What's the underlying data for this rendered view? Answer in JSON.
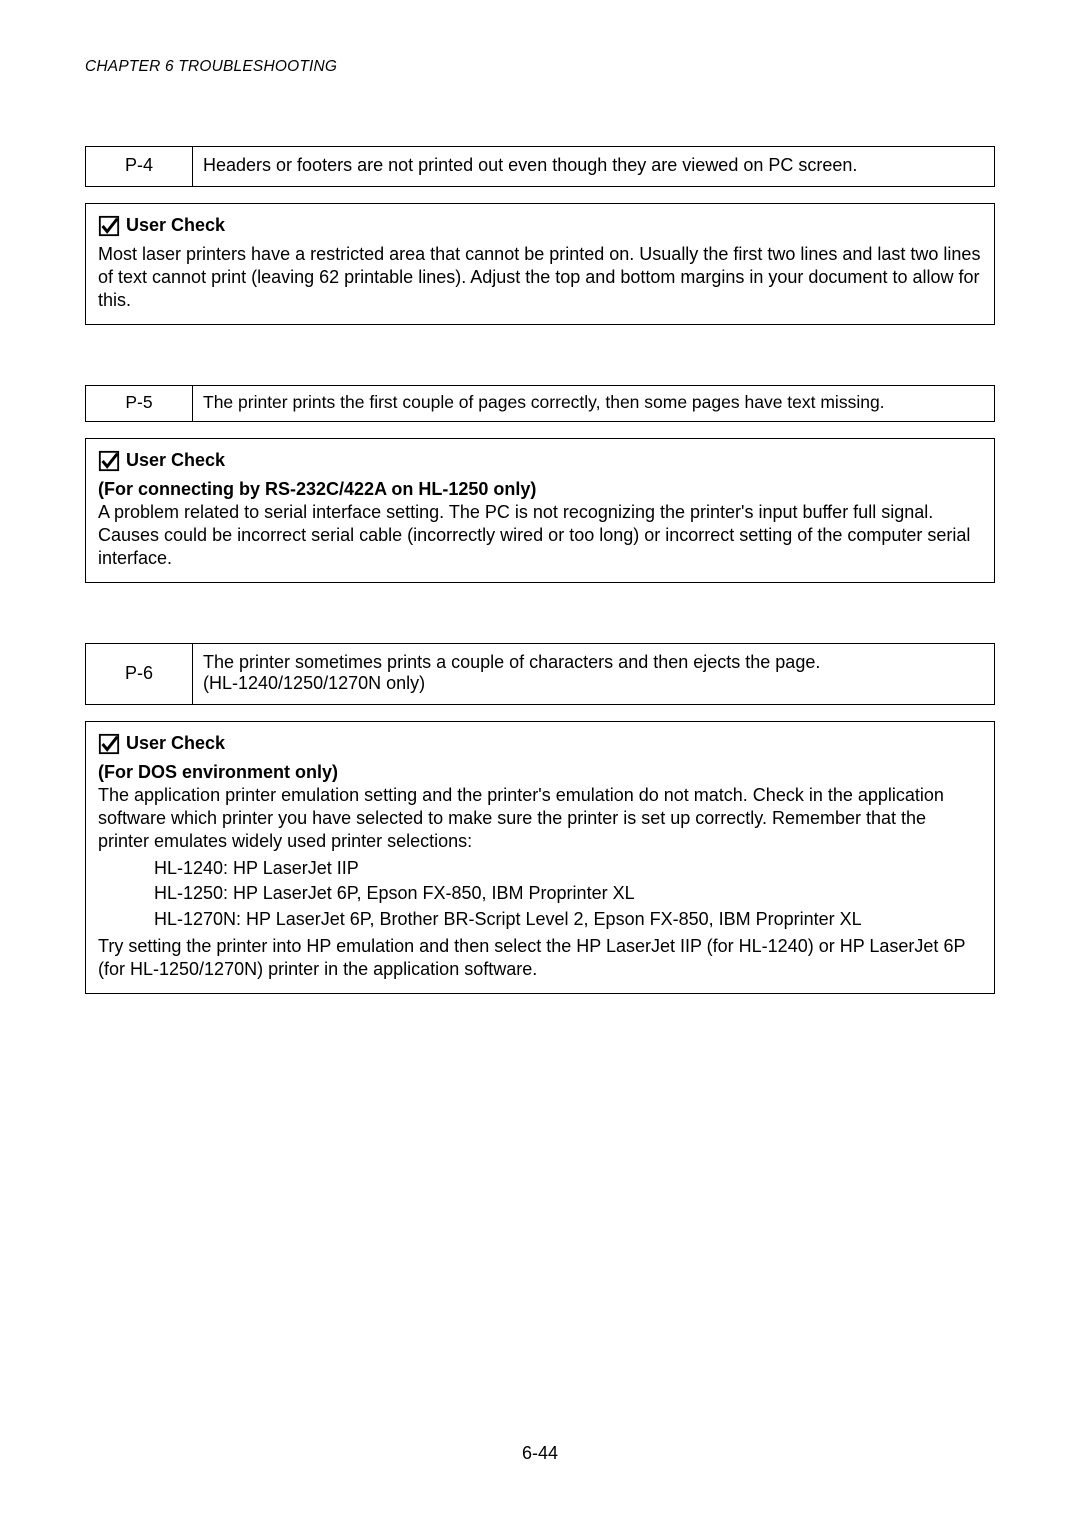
{
  "header": "CHAPTER 6  TROUBLESHOOTING",
  "page_number": "6-44",
  "uc_label": "User Check",
  "p4": {
    "code": "P-4",
    "desc": "Headers or footers are not printed out even though they are viewed on PC screen."
  },
  "uc1": {
    "text": "Most laser printers have a restricted area that cannot be printed on.  Usually the first two lines and last two lines of text cannot print (leaving 62 printable lines).  Adjust the top and bottom margins in your document to allow for this."
  },
  "p5": {
    "code": "P-5",
    "desc": "The printer prints the first couple of pages correctly, then some pages have text missing."
  },
  "uc2": {
    "sub": "(For connecting by RS-232C/422A on HL-1250 only)",
    "text": "A problem related to serial interface setting.  The PC is not recognizing the printer's input buffer full signal.  Causes could be incorrect serial cable (incorrectly wired or too long) or incorrect setting of the computer serial interface."
  },
  "p6": {
    "code": "P-6",
    "desc1": "The printer sometimes prints a couple of characters and then ejects the page.",
    "desc2": "(HL-1240/1250/1270N only)"
  },
  "uc3": {
    "sub": "(For DOS environment only)",
    "text1": "The application printer emulation setting and the printer's emulation do not match.  Check in the application software which printer you have selected to make sure the printer is set up correctly.  Remember that the printer emulates widely used printer selections:",
    "li1": "HL-1240: HP LaserJet IIP",
    "li2": "HL-1250: HP LaserJet 6P, Epson FX-850, IBM Proprinter XL",
    "li3": "HL-1270N: HP LaserJet 6P, Brother BR-Script Level 2, Epson FX-850, IBM Proprinter XL",
    "text2": "Try setting the printer into HP emulation and then select the HP LaserJet IIP (for HL-1240) or HP LaserJet 6P (for HL-1250/1270N) printer in the application software."
  }
}
